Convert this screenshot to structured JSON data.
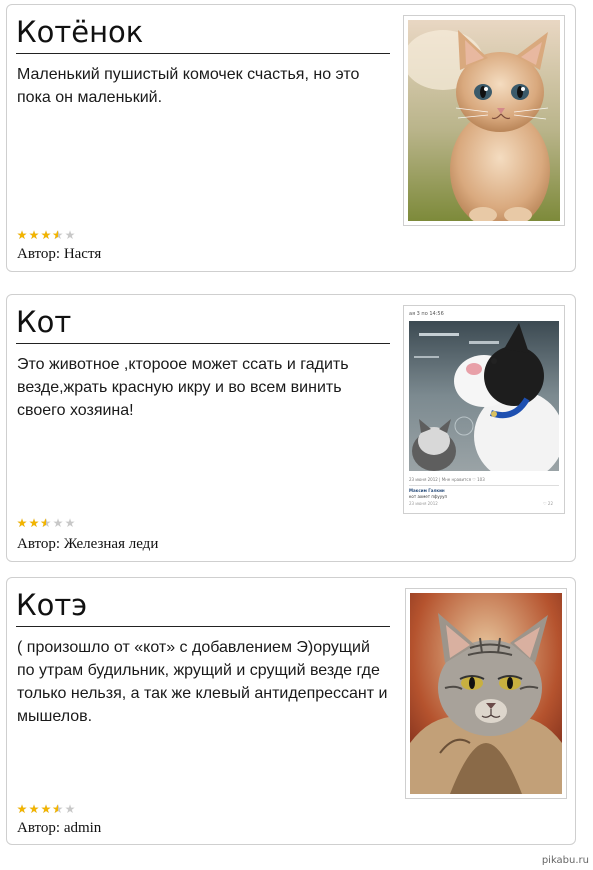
{
  "posts": [
    {
      "title": "Котёнок",
      "text": "Маленький пушистый комочек счастья, но это пока он маленький.",
      "rating": 3.5,
      "author_label": "Автор: Настя",
      "image_icon": "kitten-photo"
    },
    {
      "title": "Кот",
      "text": "Это животное ,ктороое может ссать и гадить везде,жрать красную икру и во всем винить своего хозяина!",
      "rating": 2.5,
      "author_label": "Автор: Железная леди",
      "image_icon": "cat-screenshot-photo",
      "image_caption_top": "ая 3 по 14:56",
      "image_caption_line1": "23 июня 2012 | Мне нравится ♡ 103",
      "image_caption_line2": "Максим Галкин",
      "image_caption_line3": "кот ахмет пфуууп",
      "image_caption_line4": "23 июня 2012",
      "image_caption_line4b": "♡ 22"
    },
    {
      "title": "Котэ",
      "text": "( произошло от «кот» с добавлением Э)орущий по утрам будильник, жрущий и срущий везде где только нельзя, а так же клевый антидепрессант и мышелов.",
      "rating": 3.5,
      "author_label": "Автор: admin",
      "image_icon": "cat-in-jacket-photo"
    }
  ],
  "watermark": "pikabu.ru",
  "colors": {
    "star_filled": "#f2b400",
    "star_empty": "#c8c8c8",
    "card_border": "#cfcfcf"
  }
}
